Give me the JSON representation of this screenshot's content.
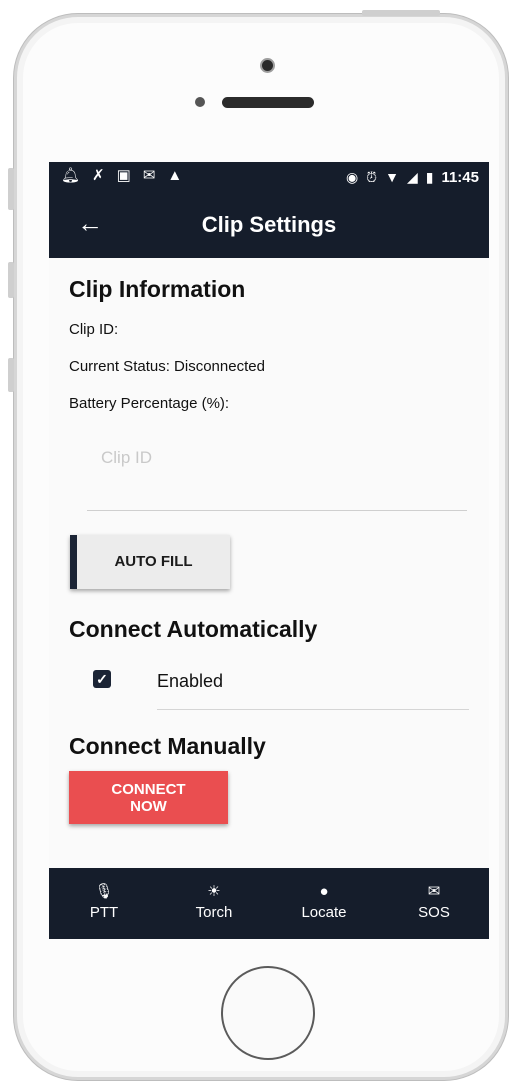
{
  "status_bar": {
    "left_icons": [
      "bell-icon",
      "missed-call-icon",
      "image-icon",
      "mail-icon",
      "warning-icon"
    ],
    "right_icons": [
      "cast-icon",
      "alarm-icon",
      "wifi-icon",
      "signal-icon",
      "battery-icon"
    ],
    "time": "11:45"
  },
  "app_bar": {
    "title": "Clip Settings",
    "back_icon": "arrow-back-icon"
  },
  "clip_information": {
    "heading": "Clip Information",
    "clip_id_label": "Clip ID:",
    "status_label": "Current Status: Disconnected",
    "battery_label": "Battery Percentage (%):",
    "clip_id_placeholder": "Clip ID",
    "clip_id_value": "",
    "auto_fill_label": "AUTO FILL"
  },
  "connect_automatically": {
    "heading": "Connect Automatically",
    "checkbox_checked": true,
    "enabled_label": "Enabled"
  },
  "connect_manually": {
    "heading": "Connect Manually",
    "button_label_line1": "CONNECT",
    "button_label_line2": "NOW"
  },
  "bottom_nav": [
    {
      "label": "PTT",
      "icon": "microphone-icon"
    },
    {
      "label": "Torch",
      "icon": "torch-icon"
    },
    {
      "label": "Locate",
      "icon": "location-pin-icon"
    },
    {
      "label": "SOS",
      "icon": "envelope-icon"
    }
  ],
  "colors": {
    "primary": "#151d2b",
    "accent_red": "#ea4e50",
    "background": "#fafafa"
  }
}
